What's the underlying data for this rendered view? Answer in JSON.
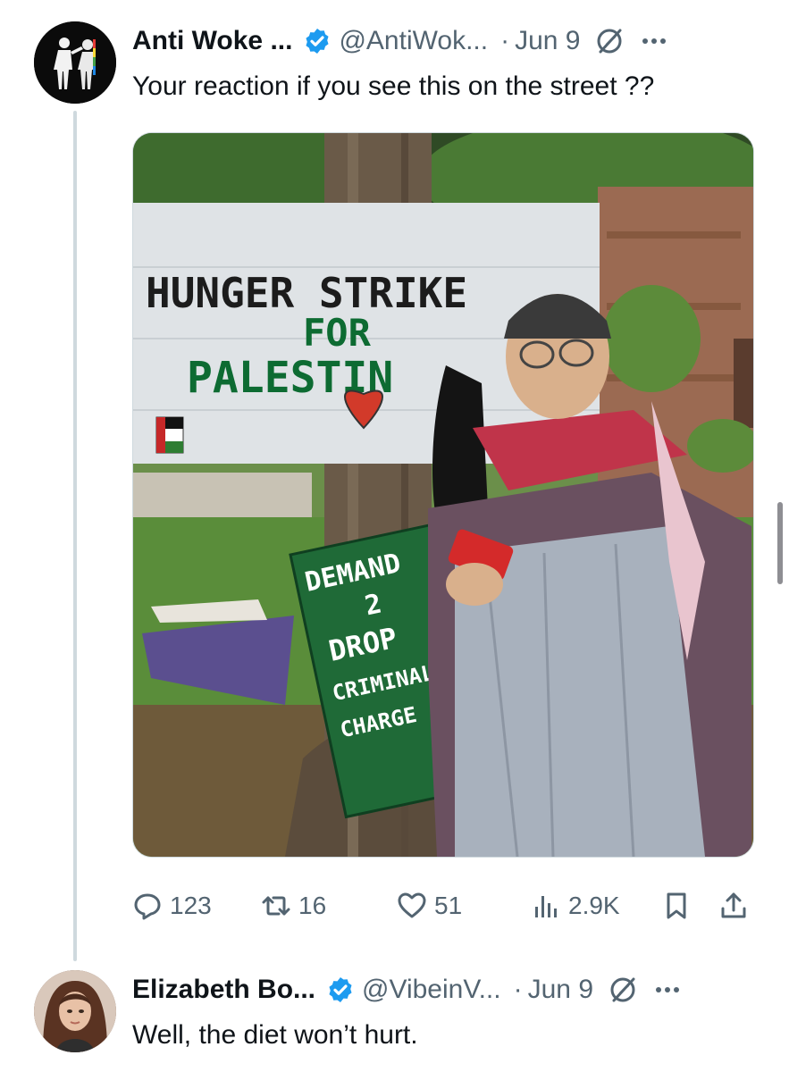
{
  "tweet": {
    "author_name": "Anti Woke ...",
    "author_handle": "@AntiWok...",
    "separator": "·",
    "date": "Jun 9",
    "text": "Your reaction if you see this on the street ??",
    "media": {
      "sign_line1": "HUNGER STRIKE",
      "sign_line2": "FOR",
      "sign_line3": "PALESTIN",
      "sign2_line1": "DEMAND",
      "sign2_line2": "2",
      "sign2_line3": "DROP",
      "sign2_line4": "CRIMINAL",
      "sign2_line5": "CHARGE"
    },
    "stats": {
      "replies": "123",
      "retweets": "16",
      "likes": "51",
      "views": "2.9K"
    }
  },
  "reply": {
    "author_name": "Elizabeth Bo...",
    "author_handle": "@VibeinV...",
    "separator": "·",
    "date": "Jun 9",
    "text": "Well, the diet won’t hurt."
  },
  "icons": {
    "verified": "verified-badge-icon",
    "edit": "edit-restricted-icon",
    "more": "more-icon",
    "reply": "reply-icon",
    "retweet": "retweet-icon",
    "like": "heart-icon",
    "views": "views-icon",
    "bookmark": "bookmark-icon",
    "share": "share-icon"
  },
  "colors": {
    "verified": "#1d9bf0",
    "secondary_text": "#536471",
    "primary_text": "#0f1419",
    "thread_line": "#cfd9de"
  }
}
